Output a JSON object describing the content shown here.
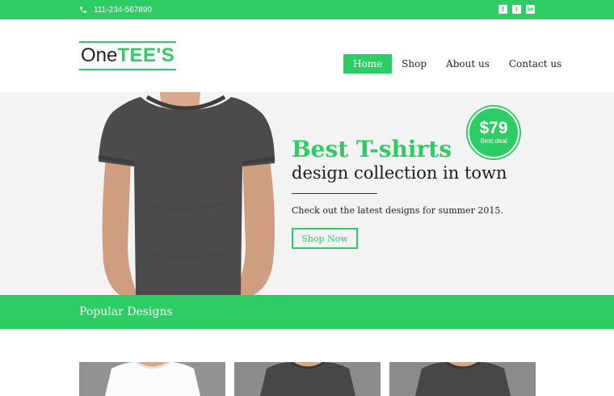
{
  "topbar": {
    "phone": "111-234-567890",
    "phone_icon": "phone-icon",
    "socials": [
      {
        "icon": "facebook-icon",
        "glyph": "f"
      },
      {
        "icon": "twitter-icon",
        "glyph": "t"
      },
      {
        "icon": "linkedin-icon",
        "glyph": "in"
      }
    ]
  },
  "logo": {
    "part1": "One",
    "part2": "TEE'S"
  },
  "nav": {
    "items": [
      {
        "label": "Home",
        "active": true
      },
      {
        "label": "Shop",
        "active": false
      },
      {
        "label": "About us",
        "active": false
      },
      {
        "label": "Contact us",
        "active": false
      }
    ]
  },
  "hero": {
    "title": "Best T-shirts",
    "subtitle": "design collection in town",
    "description": "Check out the latest designs for summer 2015.",
    "cta_label": "Shop Now",
    "badge_price": "$79",
    "badge_label": "Best deal"
  },
  "section": {
    "title": "Popular Designs"
  },
  "products": [
    {
      "shirt_color": "white"
    },
    {
      "shirt_color": "dark-gray"
    },
    {
      "shirt_color": "dark-gray"
    }
  ],
  "colors": {
    "accent": "#2ecc65",
    "hero_background": "#f3f3f3",
    "text_dark": "#222222"
  }
}
